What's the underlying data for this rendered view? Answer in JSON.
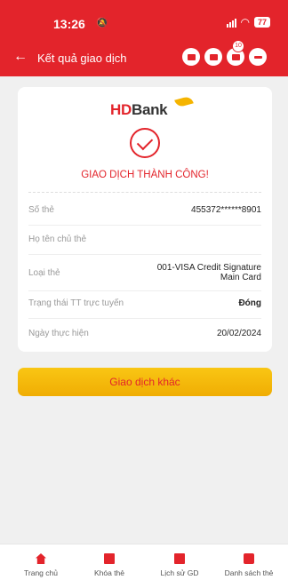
{
  "status_bar": {
    "time": "13:26",
    "mute_icon": "bell-slash-icon",
    "battery": "77"
  },
  "header": {
    "back_icon": "arrow-left-icon",
    "title": "Kết quả giao dịch",
    "action_icons": [
      "card-scan-icon",
      "card-grid-icon",
      "notification-icon",
      "menu-icon"
    ],
    "badge_count": "10"
  },
  "card": {
    "logo_hd": "HD",
    "logo_bank": "Bank",
    "status_text": "GIAO DỊCH THÀNH CÔNG!",
    "rows": [
      {
        "label": "Số thẻ",
        "value": "455372******8901"
      },
      {
        "label": "Họ tên chủ thẻ",
        "value": ""
      },
      {
        "label": "Loại thẻ",
        "value_line1": "001-VISA Credit Signature",
        "value_line2": "Main Card"
      },
      {
        "label": "Trạng thái TT trực tuyến",
        "value": "Đóng"
      },
      {
        "label": "Ngày thực hiện",
        "value": "20/02/2024"
      }
    ]
  },
  "actions": {
    "primary_label": "Giao dịch khác"
  },
  "bottom_nav": [
    {
      "label": "Trang chủ",
      "icon": "home-icon"
    },
    {
      "label": "Khóa thẻ",
      "icon": "card-lock-icon"
    },
    {
      "label": "Lịch sử GD",
      "icon": "history-icon"
    },
    {
      "label": "Danh sách thẻ",
      "icon": "card-list-icon"
    }
  ],
  "colors": {
    "primary_red": "#e3242b",
    "button_yellow": "#f5b400"
  }
}
